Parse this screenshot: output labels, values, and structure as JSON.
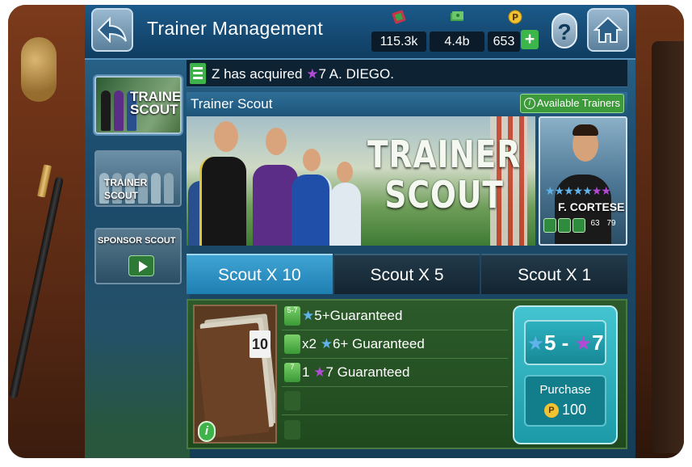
{
  "header": {
    "title": "Trainer Management",
    "currencies": [
      {
        "icon": "trainer-points-icon",
        "value": "115.3k"
      },
      {
        "icon": "cash-icon",
        "value": "4.4b"
      },
      {
        "icon": "p-coin-icon",
        "value": "653"
      }
    ],
    "plus_label": "+",
    "help_label": "?"
  },
  "ticker": {
    "text_before": "Z has acquired ",
    "star": "★",
    "text_after": "7 A. DIEGO."
  },
  "side_menu": [
    {
      "label": "TRAINER SCOUT",
      "active": true
    },
    {
      "label": "TRAINER SCOUT",
      "active": false
    },
    {
      "label": "SPONSOR SCOUT",
      "active": false
    }
  ],
  "panel": {
    "title": "Trainer Scout",
    "available_label": "Available Trainers",
    "info_icon_label": "i",
    "banner_text_line1": "TRAINER",
    "banner_text_line2": "SCOUT"
  },
  "trainer_card": {
    "name": "F. CORTESE",
    "stats": [
      "63",
      "79"
    ]
  },
  "tabs": [
    {
      "label": "Scout X 10",
      "active": true
    },
    {
      "label": "Scout X 5",
      "active": false
    },
    {
      "label": "Scout X 1",
      "active": false
    }
  ],
  "scout": {
    "folder_number": "10",
    "info_label": "i",
    "rows": [
      {
        "icon_text": "5-7",
        "text": "5+Guaranteed",
        "prefix": ""
      },
      {
        "icon_text": "",
        "text": "6+ Guaranteed",
        "prefix": "x2 "
      },
      {
        "icon_text": "7",
        "text": "7 Guaranteed",
        "prefix": "1 "
      }
    ],
    "range_from": "5",
    "range_sep": "-",
    "range_to": "7",
    "purchase_label": "Purchase",
    "price": "100",
    "coin_label": "P"
  },
  "colors": {
    "accent_blue": "#1f7fb2",
    "accent_green": "#3db34a",
    "star_blue": "#5fb3ea",
    "star_purple": "#b24ad6",
    "purchase_teal": "#1c9aa8"
  }
}
